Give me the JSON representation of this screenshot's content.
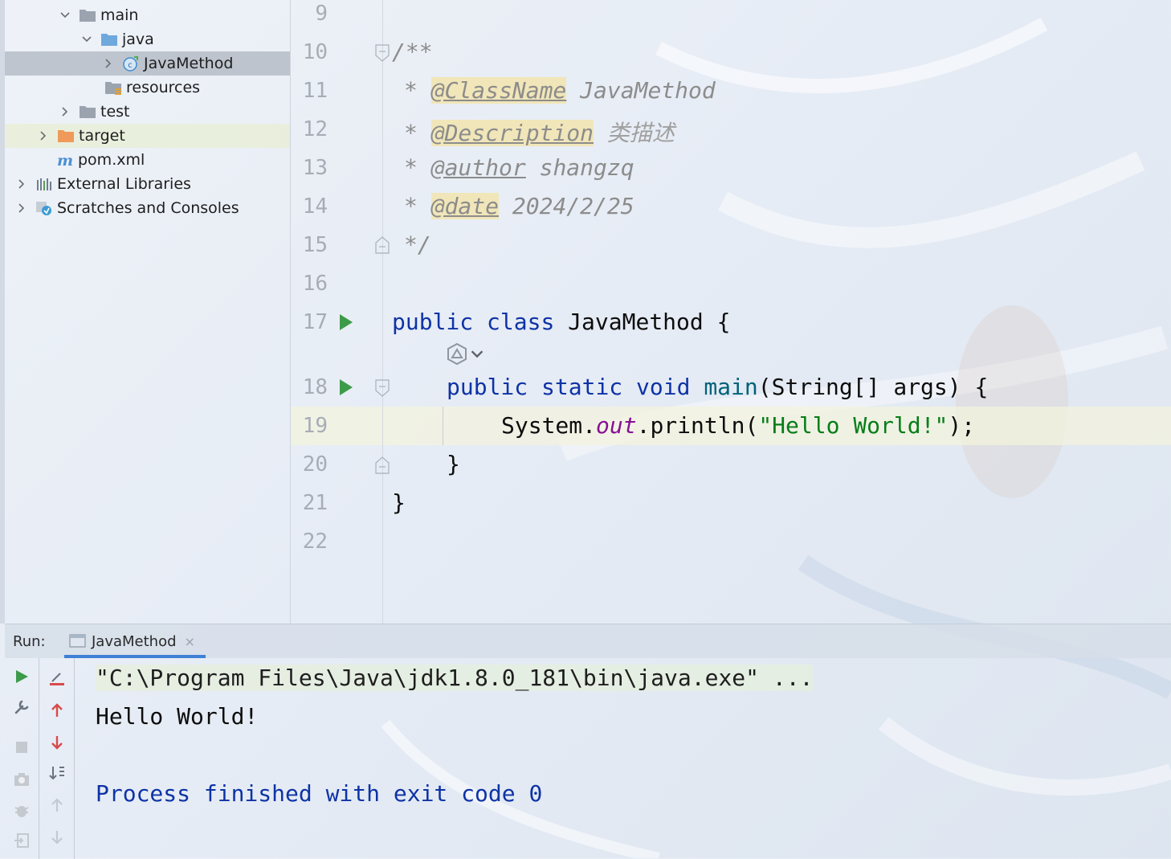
{
  "project_tree": {
    "items": [
      {
        "label": "main",
        "icon": "folder-icon",
        "expanded": true
      },
      {
        "label": "java",
        "icon": "source-folder-icon",
        "expanded": true
      },
      {
        "label": "JavaMethod",
        "icon": "java-class-icon",
        "selected": true
      },
      {
        "label": "resources",
        "icon": "resources-folder-icon"
      },
      {
        "label": "test",
        "icon": "folder-icon",
        "expanded": false
      },
      {
        "label": "target",
        "icon": "excluded-folder-icon",
        "expanded": false
      },
      {
        "label": "pom.xml",
        "icon": "maven-icon"
      },
      {
        "label": "External Libraries",
        "icon": "libraries-icon",
        "expanded": false
      },
      {
        "label": "Scratches and Consoles",
        "icon": "scratches-icon",
        "expanded": false
      }
    ]
  },
  "editor": {
    "line_numbers": [
      "9",
      "10",
      "11",
      "12",
      "13",
      "14",
      "15",
      "16",
      "17",
      "18",
      "19",
      "20",
      "21",
      "22"
    ],
    "doc": {
      "open": "/**",
      "star": "*",
      "classname_tag": "@ClassName",
      "classname_value": "JavaMethod",
      "description_tag": "@Description",
      "description_value": "类描述",
      "author_tag": "@author",
      "author_value": "shangzq",
      "date_tag": "@date",
      "date_value": "2024/2/25",
      "close": "*/"
    },
    "code": {
      "kw_public": "public",
      "kw_class": "class",
      "class_name": "JavaMethod",
      "open_brace": "{",
      "kw_static": "static",
      "kw_void": "void",
      "method_name": "main",
      "params": "(String[] args)",
      "system": "System.",
      "out": "out",
      "println": ".println(",
      "string_literal": "\"Hello World!\"",
      "end_stmt": ");",
      "close_brace": "}"
    }
  },
  "run": {
    "label": "Run:",
    "tab_title": "JavaMethod",
    "tab_close": "×",
    "console": {
      "command": "\"C:\\Program Files\\Java\\jdk1.8.0_181\\bin\\java.exe\" ...",
      "output": "Hello World!",
      "exit_message": "Process finished with exit code 0"
    },
    "colors": {
      "output": "#0d0d0d",
      "exit": "#0e33a6",
      "run_green": "#3c9b4a",
      "stop_red": "#d84a4a"
    }
  }
}
